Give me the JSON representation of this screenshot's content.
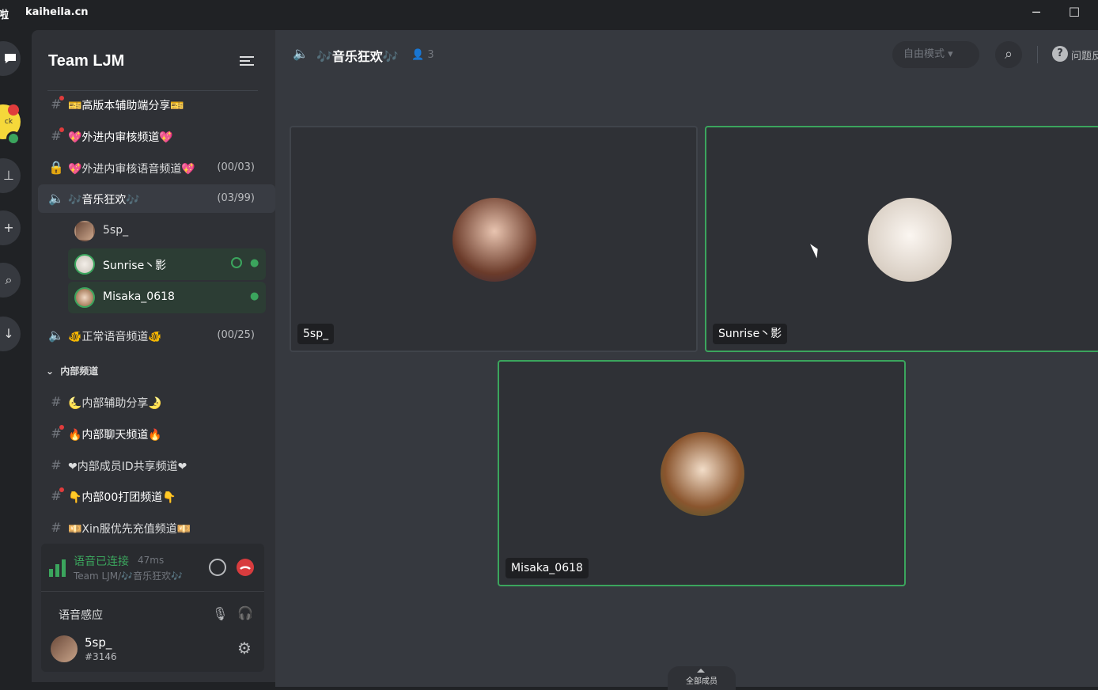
{
  "titlebar": {
    "app_partial": "啦",
    "domain": "kaiheila.cn",
    "minimize": "─",
    "maximize": "☐"
  },
  "rail": {
    "icons": [
      "chat-icon",
      "server-avatar",
      "user-icon",
      "add-icon",
      "search-icon",
      "download-icon"
    ],
    "server_avatar_text": "ck"
  },
  "server": {
    "name": "Team LJM"
  },
  "channels": [
    {
      "type": "text",
      "label": "🎫高版本辅助端分享🎫",
      "unread": true
    },
    {
      "type": "text",
      "label": "💖外进内审核频道💖",
      "unread": true
    },
    {
      "type": "locked",
      "label": "💖外进内审核语音频道💖",
      "count": "(00/03)"
    },
    {
      "type": "voice",
      "label": "🎶音乐狂欢🎶",
      "count": "(03/99)",
      "active": true
    },
    {
      "type": "voice",
      "label": "🐠正常语音频道🐠",
      "count": "(00/25)"
    }
  ],
  "voice_users": [
    {
      "name": "5sp_",
      "speaking": false
    },
    {
      "name": "Sunrise丶影",
      "speaking": true
    },
    {
      "name": "Misaka_0618",
      "speaking": true
    }
  ],
  "category": {
    "label": "内部频道"
  },
  "internal_channels": [
    {
      "label": "🌜内部辅助分享🌛",
      "unread": false
    },
    {
      "label": "🔥内部聊天频道🔥",
      "unread": true
    },
    {
      "label": "❤内部成员ID共享频道❤",
      "unread": false
    },
    {
      "label": "👇内部00打团频道👇",
      "unread": true
    },
    {
      "label": "💴Xin服优先充值频道💴",
      "unread": false
    }
  ],
  "voice_panel": {
    "status": "语音已连接",
    "ping": "47ms",
    "path": "Team LJM/🎶音乐狂欢🎶",
    "mode": "语音感应",
    "username": "5sp_",
    "tag": "#3146"
  },
  "main": {
    "channel_title": "🎶音乐狂欢🎶",
    "member_count": "3",
    "mode_label": "自由模式",
    "help_label": "问题反",
    "members_button": "全部成员"
  },
  "tiles": [
    {
      "name": "5sp_",
      "speaking": false
    },
    {
      "name": "Sunrise丶影",
      "speaking": true
    },
    {
      "name": "Misaka_0618",
      "speaking": true
    }
  ],
  "colors": {
    "accent_green": "#3ba55d",
    "hangup_red": "#d83c3e",
    "unread_red": "#e03c3c"
  }
}
